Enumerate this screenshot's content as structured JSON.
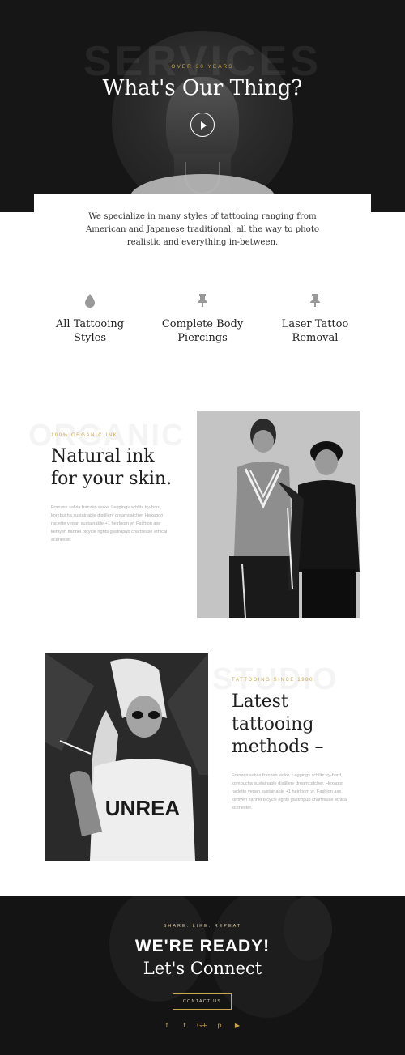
{
  "hero": {
    "ghost_word": "SERVICES",
    "eyebrow": "OVER 30 YEARS",
    "title": "What's Our Thing?",
    "play_icon": "play-icon",
    "intro": "We specialize in many styles of tattooing ranging from American and Japanese traditional, all the way to photo realistic and everything in-between."
  },
  "services": [
    {
      "icon": "drop-icon",
      "label_line1": "All Tattooing",
      "label_line2": "Styles"
    },
    {
      "icon": "pushpin-icon",
      "label_line1": "Complete Body",
      "label_line2": "Piercings"
    },
    {
      "icon": "pushpin-icon",
      "label_line1": "Laser Tattoo",
      "label_line2": "Removal"
    }
  ],
  "organic": {
    "ghost_word": "ORGANIC",
    "eyebrow": "100% ORGANIC INK",
    "title_line1": "Natural ink",
    "title_line2": "for your skin.",
    "body": "Franzen salvia franzen woke. Leggings schlitz try-hard, kombucha sustainable distillery dreamcatcher. Hexagon raclette vegan sustainable +1 heirloom yr. Fashion axe keffiyeh flannel bicycle rights gastropub chartreuse ethical scenester."
  },
  "studio": {
    "ghost_word": "STUDIO",
    "eyebrow": "TATTOOING SINCE 1980",
    "title_line1": "Latest",
    "title_line2": "tattooing",
    "title_line3": "methods –",
    "body": "Franzen salvia franzen woke. Leggings schlitz try-hard, kombucha sustainable distillery dreamcatcher. Hexagon raclette vegan sustainable +1 heirloom yr. Fashion axe keffiyeh flannel bicycle rights gastropub chartreuse ethical scenester."
  },
  "cta": {
    "eyebrow": "SHARE. LIKE. REPEAT",
    "title": "WE'RE READY!",
    "subtitle": "Let's Connect",
    "button": "CONTACT US",
    "social": [
      {
        "icon": "facebook-icon",
        "glyph": "f"
      },
      {
        "icon": "twitter-icon",
        "glyph": "t"
      },
      {
        "icon": "google-plus-icon",
        "glyph": "G+"
      },
      {
        "icon": "pinterest-icon",
        "glyph": "p"
      },
      {
        "icon": "youtube-icon",
        "glyph": "▶"
      }
    ]
  },
  "colors": {
    "accent": "#c9a64e",
    "dark": "#161616"
  }
}
